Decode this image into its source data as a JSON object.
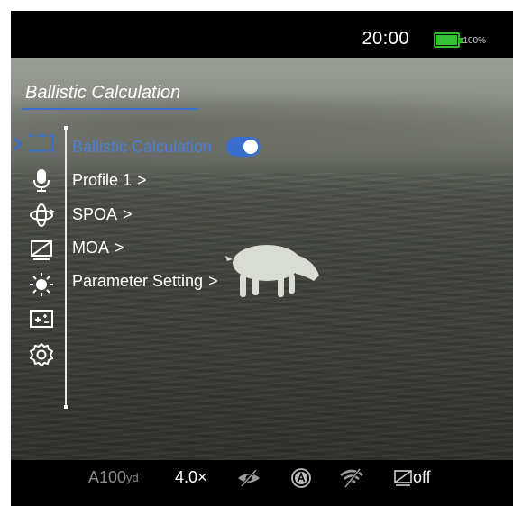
{
  "status": {
    "time": "20:00",
    "battery_percent": "100%",
    "battery_level": 1.0,
    "battery_color": "#33c233"
  },
  "page": {
    "title": "Ballistic Calculation",
    "accent_color": "#3a6fd0"
  },
  "sidebar": {
    "icons": [
      {
        "name": "ballistic-reticle-icon",
        "selected": true
      },
      {
        "name": "microphone-icon",
        "selected": false
      },
      {
        "name": "rotate-icon",
        "selected": false
      },
      {
        "name": "display-off-icon",
        "selected": false
      },
      {
        "name": "brightness-icon",
        "selected": false
      },
      {
        "name": "image-enhance-icon",
        "selected": false
      },
      {
        "name": "settings-gear-icon",
        "selected": false
      }
    ]
  },
  "menu": {
    "items": [
      {
        "label": "Ballistic Calculation",
        "toggle": "on"
      },
      {
        "label": "Profile 1",
        "arrow": ">"
      },
      {
        "label": "SPOA",
        "arrow": ">"
      },
      {
        "label": "MOA",
        "arrow": ">"
      },
      {
        "label": "Parameter Setting",
        "arrow": ">"
      }
    ]
  },
  "bottom": {
    "range_prefix": "A100",
    "range_unit": "yd",
    "zoom": "4.0×",
    "display_state": "off",
    "icons": [
      "eye-off-icon",
      "auto-mode-icon",
      "wifi-off-icon",
      "display-off-small-icon"
    ]
  }
}
